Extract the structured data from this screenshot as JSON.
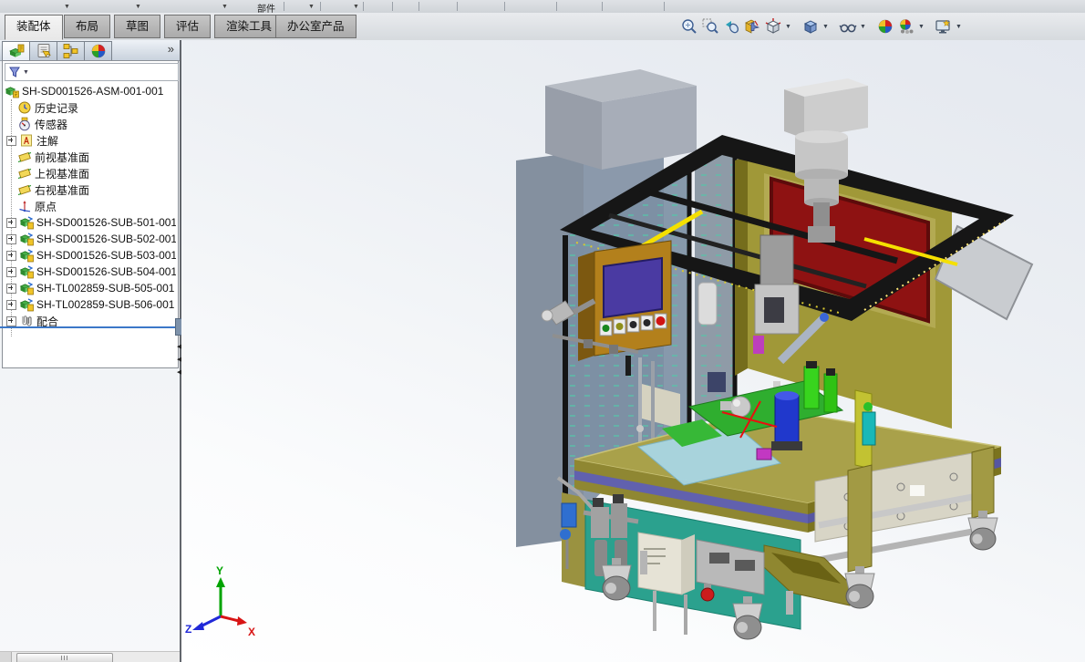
{
  "top_strip": {
    "partial_toolbar_label": "部件"
  },
  "ribbon": {
    "tabs": [
      {
        "label": "装配体",
        "active": true
      },
      {
        "label": "布局",
        "active": false
      },
      {
        "label": "草图",
        "active": false
      },
      {
        "label": "评估",
        "active": false
      },
      {
        "label": "渲染工具",
        "active": false
      },
      {
        "label": "办公室产品",
        "active": false
      }
    ]
  },
  "left_panel": {
    "tabs": [
      {
        "name": "featuremanager-design-tree"
      },
      {
        "name": "propertymanager"
      },
      {
        "name": "configurationmanager"
      },
      {
        "name": "displaymanager"
      }
    ],
    "overflow_label": "»",
    "tree": {
      "items": [
        {
          "label": "SH-SD001526-ASM-001-001",
          "icon": "assembly",
          "expandable": false
        },
        {
          "label": "历史记录",
          "icon": "history",
          "expandable": false
        },
        {
          "label": "传感器",
          "icon": "sensors",
          "expandable": false
        },
        {
          "label": "注解",
          "icon": "annotations",
          "expandable": true
        },
        {
          "label": "前视基准面",
          "icon": "plane",
          "expandable": false
        },
        {
          "label": "上视基准面",
          "icon": "plane",
          "expandable": false
        },
        {
          "label": "右视基准面",
          "icon": "plane",
          "expandable": false
        },
        {
          "label": "原点",
          "icon": "origin",
          "expandable": false
        },
        {
          "label": "SH-SD001526-SUB-501-001",
          "icon": "subassembly",
          "expandable": true
        },
        {
          "label": "SH-SD001526-SUB-502-001",
          "icon": "subassembly",
          "expandable": true
        },
        {
          "label": "SH-SD001526-SUB-503-001",
          "icon": "subassembly",
          "expandable": true
        },
        {
          "label": "SH-SD001526-SUB-504-001",
          "icon": "subassembly",
          "expandable": true
        },
        {
          "label": "SH-TL002859-SUB-505-001",
          "icon": "subassembly",
          "expandable": true
        },
        {
          "label": "SH-TL002859-SUB-506-001",
          "icon": "subassembly",
          "expandable": true
        },
        {
          "label": "配合",
          "icon": "mates",
          "expandable": true
        }
      ]
    }
  },
  "heads_up_toolbar": {
    "buttons": [
      {
        "name": "zoom-to-fit",
        "dropdown": false
      },
      {
        "name": "zoom-to-area",
        "dropdown": false
      },
      {
        "name": "previous-view",
        "dropdown": false
      },
      {
        "name": "section-view",
        "dropdown": false
      },
      {
        "name": "view-orientation",
        "dropdown": true
      },
      {
        "name": "display-style",
        "dropdown": true
      },
      {
        "name": "hide-show-items",
        "dropdown": true
      },
      {
        "name": "edit-appearance",
        "dropdown": false
      },
      {
        "name": "apply-scene",
        "dropdown": true
      },
      {
        "name": "view-settings",
        "dropdown": true
      }
    ]
  },
  "viewport": {
    "triad": {
      "x": "X",
      "y": "Y",
      "z": "Z"
    }
  },
  "colors": {
    "selection_blue": "#3c78c8",
    "viewport_top": "#e4e8ef",
    "viewport_bottom": "#ffffff",
    "cage_frame": "#161616",
    "mesh_panel": "#7b8fa3",
    "mesh_dots": "#52c8aa",
    "machine_olive": "#a09838",
    "red_panel": "#8e1212",
    "table_teal_panel": "#2ba18e",
    "stripe_purple": "#6161ae",
    "hmi_orange": "#b3801c",
    "hmi_screen": "#4a3aa2",
    "tower_gray": "#8494a8",
    "triad_x": "#d81414",
    "triad_y": "#00a400",
    "triad_z": "#2028d8"
  }
}
